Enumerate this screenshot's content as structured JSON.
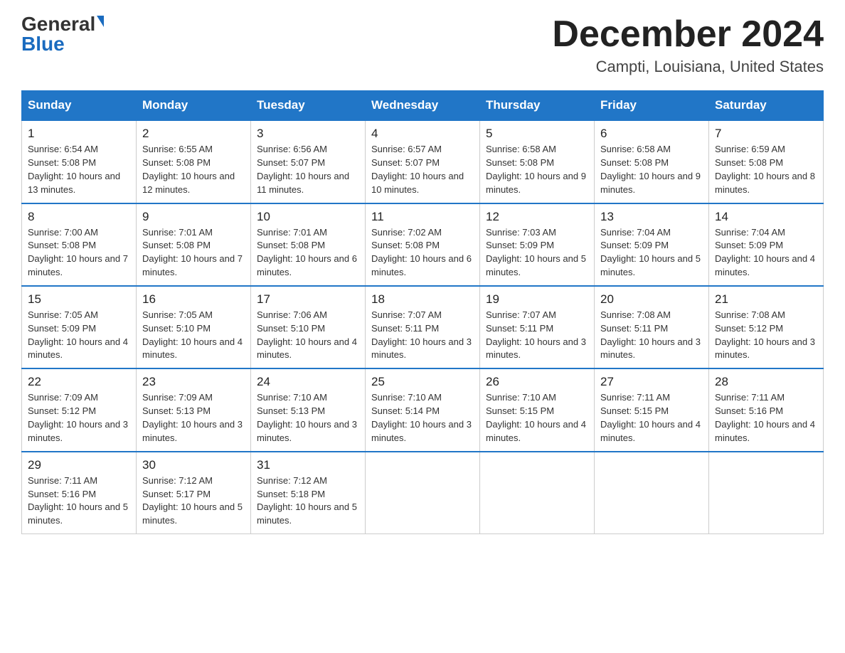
{
  "header": {
    "logo_general": "General",
    "logo_blue": "Blue",
    "month_title": "December 2024",
    "location": "Campti, Louisiana, United States"
  },
  "days_of_week": [
    "Sunday",
    "Monday",
    "Tuesday",
    "Wednesday",
    "Thursday",
    "Friday",
    "Saturday"
  ],
  "weeks": [
    [
      {
        "day": "1",
        "sunrise": "6:54 AM",
        "sunset": "5:08 PM",
        "daylight": "10 hours and 13 minutes."
      },
      {
        "day": "2",
        "sunrise": "6:55 AM",
        "sunset": "5:08 PM",
        "daylight": "10 hours and 12 minutes."
      },
      {
        "day": "3",
        "sunrise": "6:56 AM",
        "sunset": "5:07 PM",
        "daylight": "10 hours and 11 minutes."
      },
      {
        "day": "4",
        "sunrise": "6:57 AM",
        "sunset": "5:07 PM",
        "daylight": "10 hours and 10 minutes."
      },
      {
        "day": "5",
        "sunrise": "6:58 AM",
        "sunset": "5:08 PM",
        "daylight": "10 hours and 9 minutes."
      },
      {
        "day": "6",
        "sunrise": "6:58 AM",
        "sunset": "5:08 PM",
        "daylight": "10 hours and 9 minutes."
      },
      {
        "day": "7",
        "sunrise": "6:59 AM",
        "sunset": "5:08 PM",
        "daylight": "10 hours and 8 minutes."
      }
    ],
    [
      {
        "day": "8",
        "sunrise": "7:00 AM",
        "sunset": "5:08 PM",
        "daylight": "10 hours and 7 minutes."
      },
      {
        "day": "9",
        "sunrise": "7:01 AM",
        "sunset": "5:08 PM",
        "daylight": "10 hours and 7 minutes."
      },
      {
        "day": "10",
        "sunrise": "7:01 AM",
        "sunset": "5:08 PM",
        "daylight": "10 hours and 6 minutes."
      },
      {
        "day": "11",
        "sunrise": "7:02 AM",
        "sunset": "5:08 PM",
        "daylight": "10 hours and 6 minutes."
      },
      {
        "day": "12",
        "sunrise": "7:03 AM",
        "sunset": "5:09 PM",
        "daylight": "10 hours and 5 minutes."
      },
      {
        "day": "13",
        "sunrise": "7:04 AM",
        "sunset": "5:09 PM",
        "daylight": "10 hours and 5 minutes."
      },
      {
        "day": "14",
        "sunrise": "7:04 AM",
        "sunset": "5:09 PM",
        "daylight": "10 hours and 4 minutes."
      }
    ],
    [
      {
        "day": "15",
        "sunrise": "7:05 AM",
        "sunset": "5:09 PM",
        "daylight": "10 hours and 4 minutes."
      },
      {
        "day": "16",
        "sunrise": "7:05 AM",
        "sunset": "5:10 PM",
        "daylight": "10 hours and 4 minutes."
      },
      {
        "day": "17",
        "sunrise": "7:06 AM",
        "sunset": "5:10 PM",
        "daylight": "10 hours and 4 minutes."
      },
      {
        "day": "18",
        "sunrise": "7:07 AM",
        "sunset": "5:11 PM",
        "daylight": "10 hours and 3 minutes."
      },
      {
        "day": "19",
        "sunrise": "7:07 AM",
        "sunset": "5:11 PM",
        "daylight": "10 hours and 3 minutes."
      },
      {
        "day": "20",
        "sunrise": "7:08 AM",
        "sunset": "5:11 PM",
        "daylight": "10 hours and 3 minutes."
      },
      {
        "day": "21",
        "sunrise": "7:08 AM",
        "sunset": "5:12 PM",
        "daylight": "10 hours and 3 minutes."
      }
    ],
    [
      {
        "day": "22",
        "sunrise": "7:09 AM",
        "sunset": "5:12 PM",
        "daylight": "10 hours and 3 minutes."
      },
      {
        "day": "23",
        "sunrise": "7:09 AM",
        "sunset": "5:13 PM",
        "daylight": "10 hours and 3 minutes."
      },
      {
        "day": "24",
        "sunrise": "7:10 AM",
        "sunset": "5:13 PM",
        "daylight": "10 hours and 3 minutes."
      },
      {
        "day": "25",
        "sunrise": "7:10 AM",
        "sunset": "5:14 PM",
        "daylight": "10 hours and 3 minutes."
      },
      {
        "day": "26",
        "sunrise": "7:10 AM",
        "sunset": "5:15 PM",
        "daylight": "10 hours and 4 minutes."
      },
      {
        "day": "27",
        "sunrise": "7:11 AM",
        "sunset": "5:15 PM",
        "daylight": "10 hours and 4 minutes."
      },
      {
        "day": "28",
        "sunrise": "7:11 AM",
        "sunset": "5:16 PM",
        "daylight": "10 hours and 4 minutes."
      }
    ],
    [
      {
        "day": "29",
        "sunrise": "7:11 AM",
        "sunset": "5:16 PM",
        "daylight": "10 hours and 5 minutes."
      },
      {
        "day": "30",
        "sunrise": "7:12 AM",
        "sunset": "5:17 PM",
        "daylight": "10 hours and 5 minutes."
      },
      {
        "day": "31",
        "sunrise": "7:12 AM",
        "sunset": "5:18 PM",
        "daylight": "10 hours and 5 minutes."
      },
      null,
      null,
      null,
      null
    ]
  ]
}
